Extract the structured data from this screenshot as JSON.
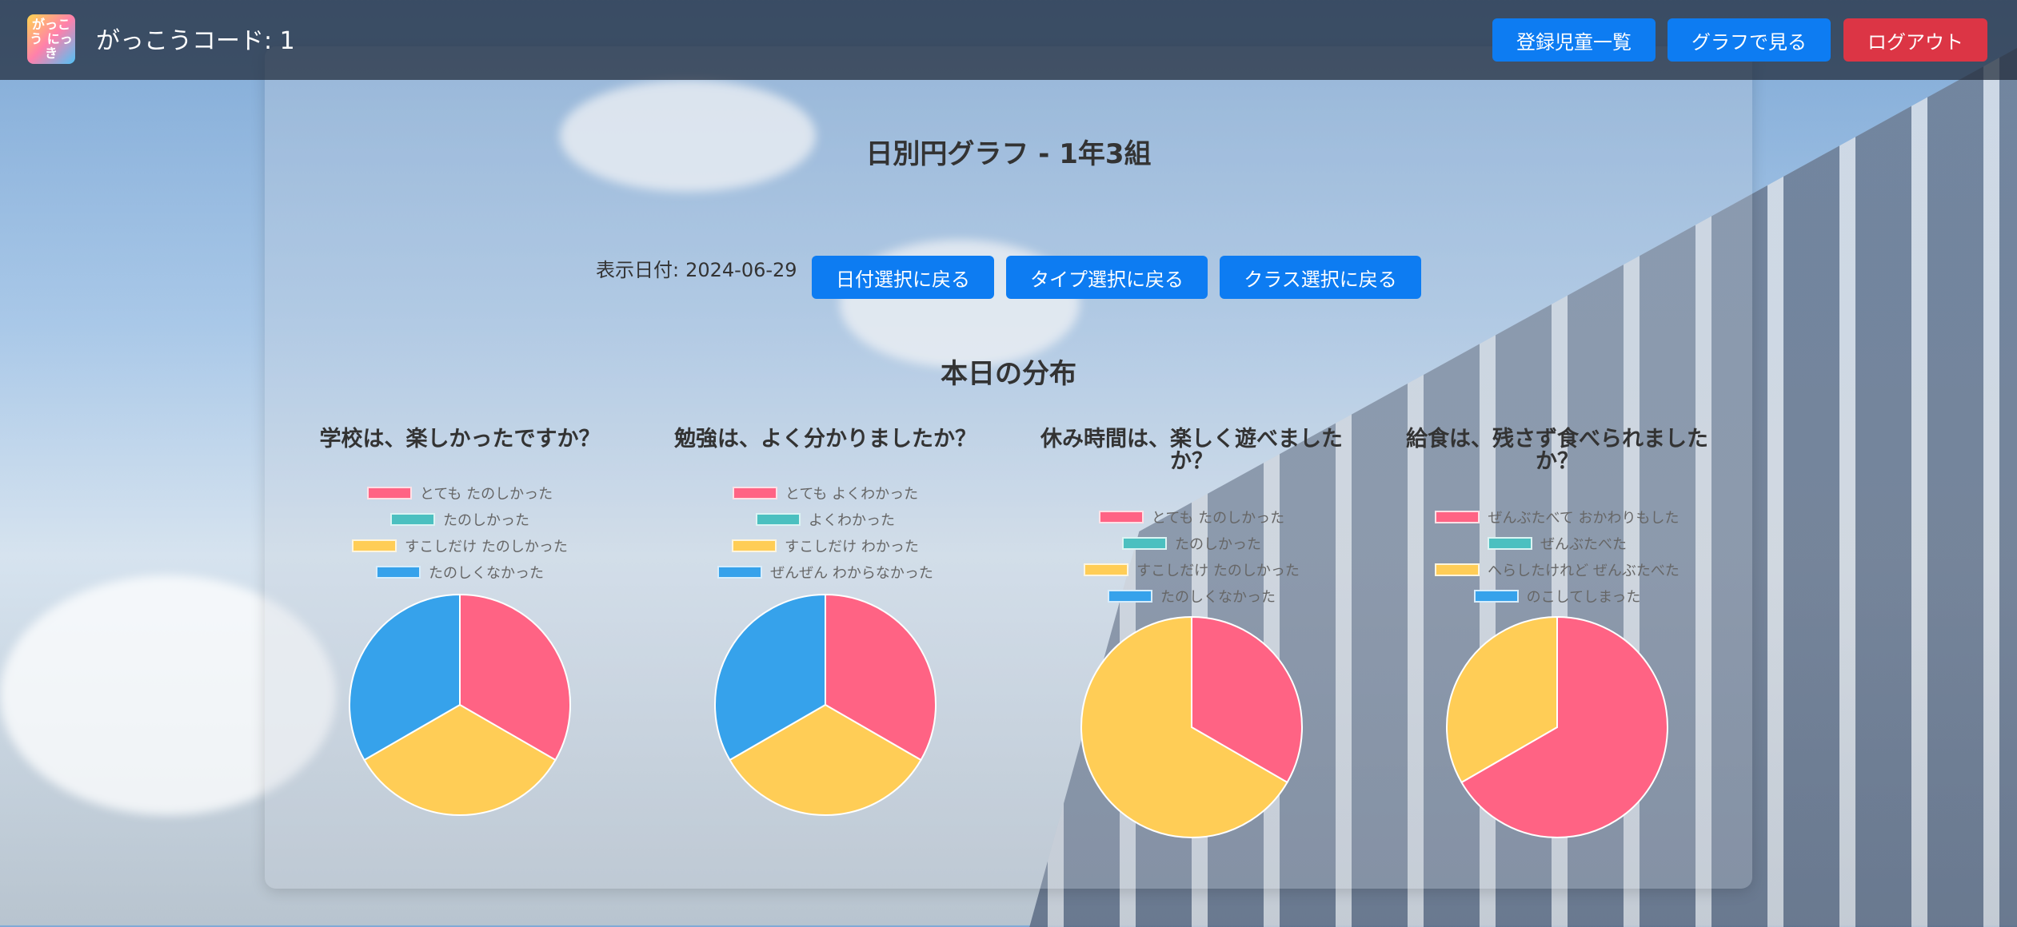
{
  "header": {
    "logo_text": "がっこう にっき",
    "school_code": "がっこうコード: 1",
    "nav": {
      "students_label": "登録児童一覧",
      "graph_label": "グラフで見る",
      "logout_label": "ログアウト"
    }
  },
  "page": {
    "title": "日別円グラフ - 1年3組",
    "date_label": "表示日付:",
    "date_value": "2024-06-29",
    "buttons": {
      "back_date": "日付選択に戻る",
      "back_type": "タイプ選択に戻る",
      "back_class": "クラス選択に戻る"
    },
    "section_title": "本日の分布"
  },
  "colors": {
    "red": "#ff6384",
    "teal": "#4bc0c0",
    "yellow": "#ffcd56",
    "blue": "#36a2eb",
    "primary": "#0d7cf2",
    "danger": "#dc3545"
  },
  "chart_data": [
    {
      "type": "pie",
      "title": "学校は、楽しかったですか？",
      "labels": [
        "とても たのしかった",
        "たのしかった",
        "すこしだけ たのしかった",
        "たのしくなかった"
      ],
      "values": [
        1,
        0,
        1,
        1
      ],
      "colors": [
        "#ff6384",
        "#4bc0c0",
        "#ffcd56",
        "#36a2eb"
      ],
      "legend": "top"
    },
    {
      "type": "pie",
      "title": "勉強は、よく分かりましたか？",
      "labels": [
        "とても よくわかった",
        "よくわかった",
        "すこしだけ わかった",
        "ぜんぜん わからなかった"
      ],
      "values": [
        1,
        0,
        1,
        1
      ],
      "colors": [
        "#ff6384",
        "#4bc0c0",
        "#ffcd56",
        "#36a2eb"
      ],
      "legend": "top"
    },
    {
      "type": "pie",
      "title": "休み時間は、楽しく遊べましたか？",
      "labels": [
        "とても たのしかった",
        "たのしかった",
        "すこしだけ たのしかった",
        "たのしくなかった"
      ],
      "values": [
        1,
        0,
        2,
        0
      ],
      "colors": [
        "#ff6384",
        "#4bc0c0",
        "#ffcd56",
        "#36a2eb"
      ],
      "legend": "top"
    },
    {
      "type": "pie",
      "title": "給食は、残さず食べられましたか？",
      "labels": [
        "ぜんぶたべて おかわりもした",
        "ぜんぶたべた",
        "へらしたけれど ぜんぶたべた",
        "のこしてしまった"
      ],
      "values": [
        2,
        0,
        1,
        0
      ],
      "colors": [
        "#ff6384",
        "#4bc0c0",
        "#ffcd56",
        "#36a2eb"
      ],
      "legend": "top"
    }
  ]
}
